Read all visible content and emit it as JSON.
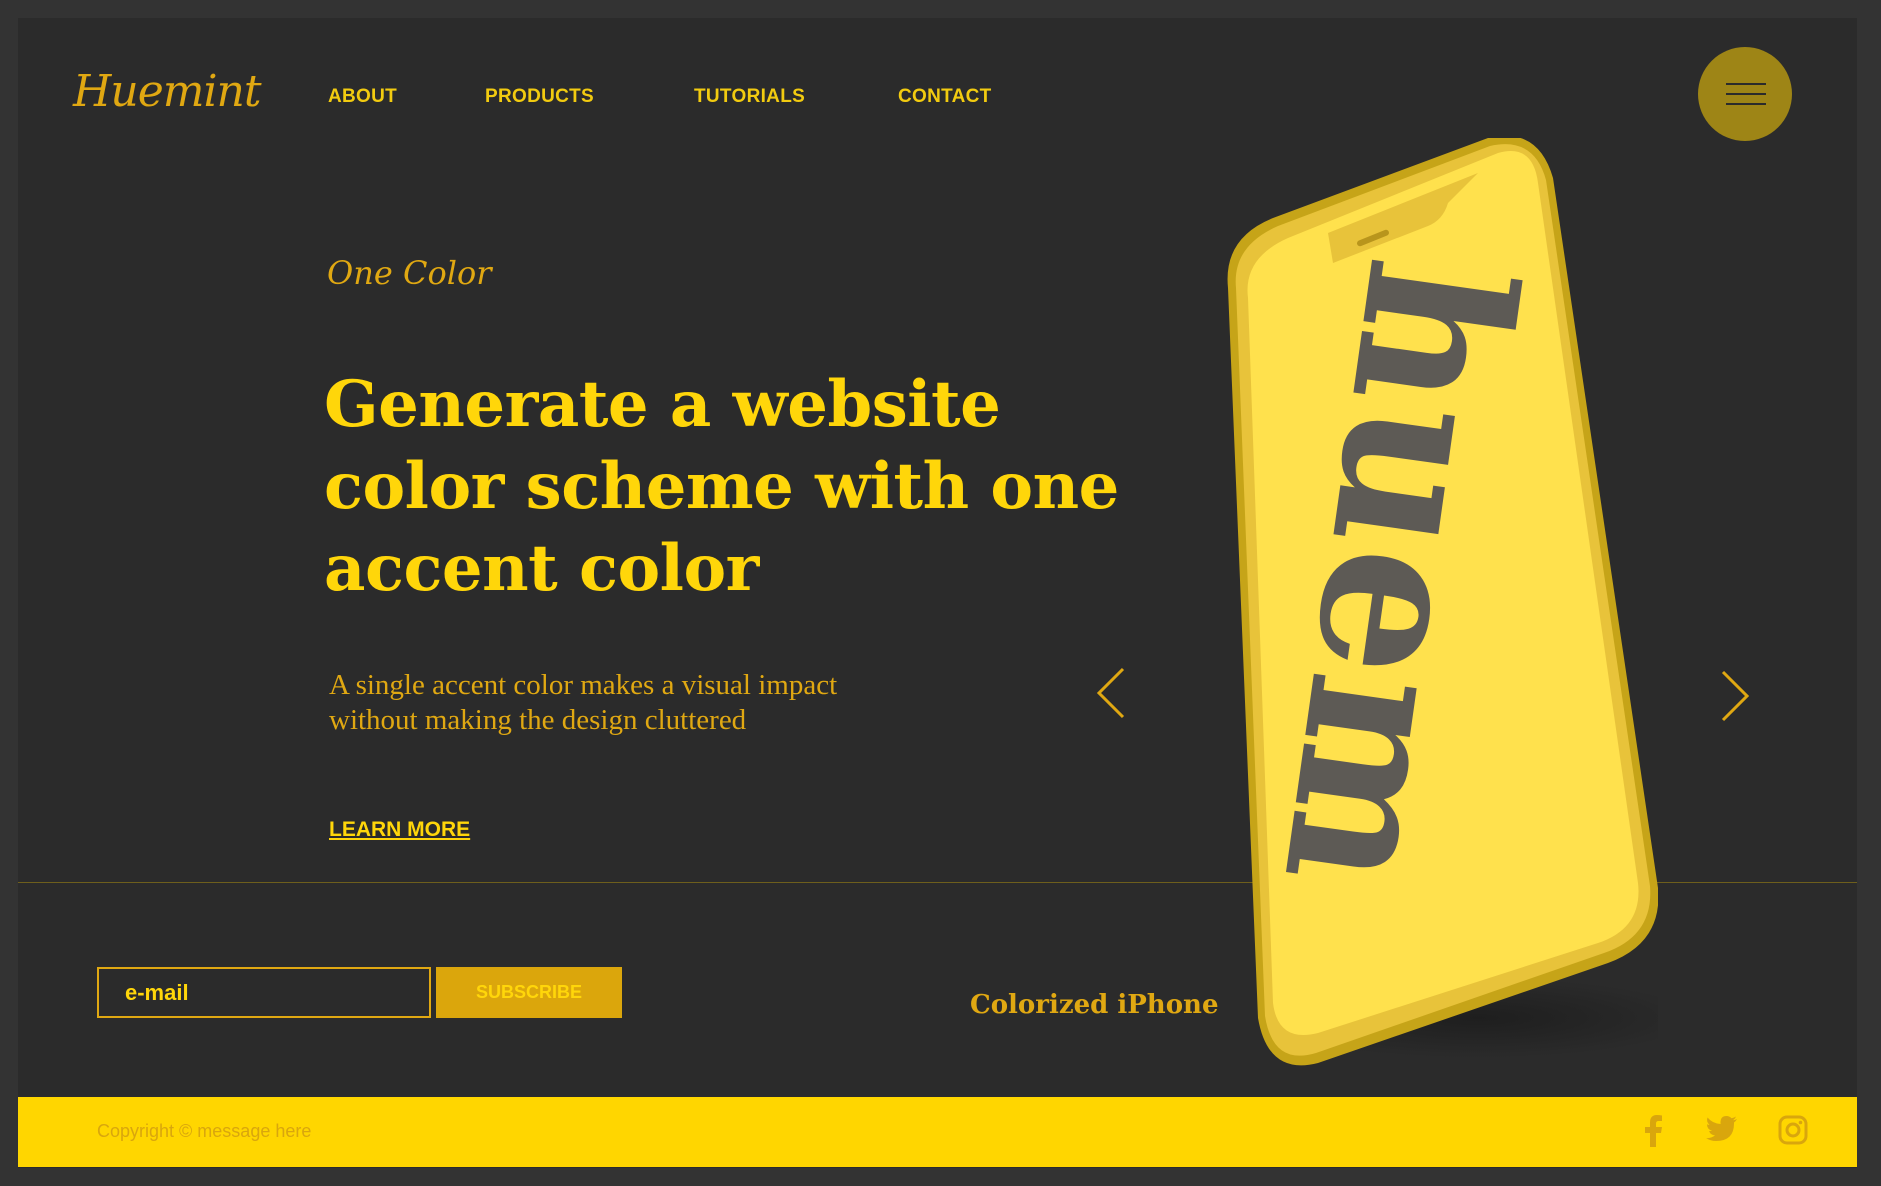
{
  "brand": {
    "logo": "Huemint"
  },
  "nav": {
    "items": [
      "ABOUT",
      "PRODUCTS",
      "TUTORIALS",
      "CONTACT"
    ]
  },
  "hero": {
    "eyebrow": "One Color",
    "headline": [
      "Generate a website",
      "color scheme with one",
      "accent color"
    ],
    "subtitle": [
      "A single accent color makes a visual impact",
      "without making the design cluttered"
    ],
    "cta": "LEARN MORE"
  },
  "product": {
    "phone_screen_text": "huem",
    "caption": "Colorized iPhone"
  },
  "newsletter": {
    "email_placeholder": "e-mail",
    "subscribe_label": "SUBSCRIBE"
  },
  "footer": {
    "copyright": "Copyright © message here"
  },
  "colors": {
    "page_bg": "#2b2b2b",
    "accent": "#ffd60a",
    "accent_dark": "#e0a812",
    "footer_bg": "#ffd600",
    "menu_button": "#9e8516"
  },
  "icons": {
    "menu": "hamburger-icon",
    "prev": "chevron-left-icon",
    "next": "chevron-right-icon",
    "social": [
      "facebook-icon",
      "twitter-icon",
      "instagram-icon"
    ]
  }
}
